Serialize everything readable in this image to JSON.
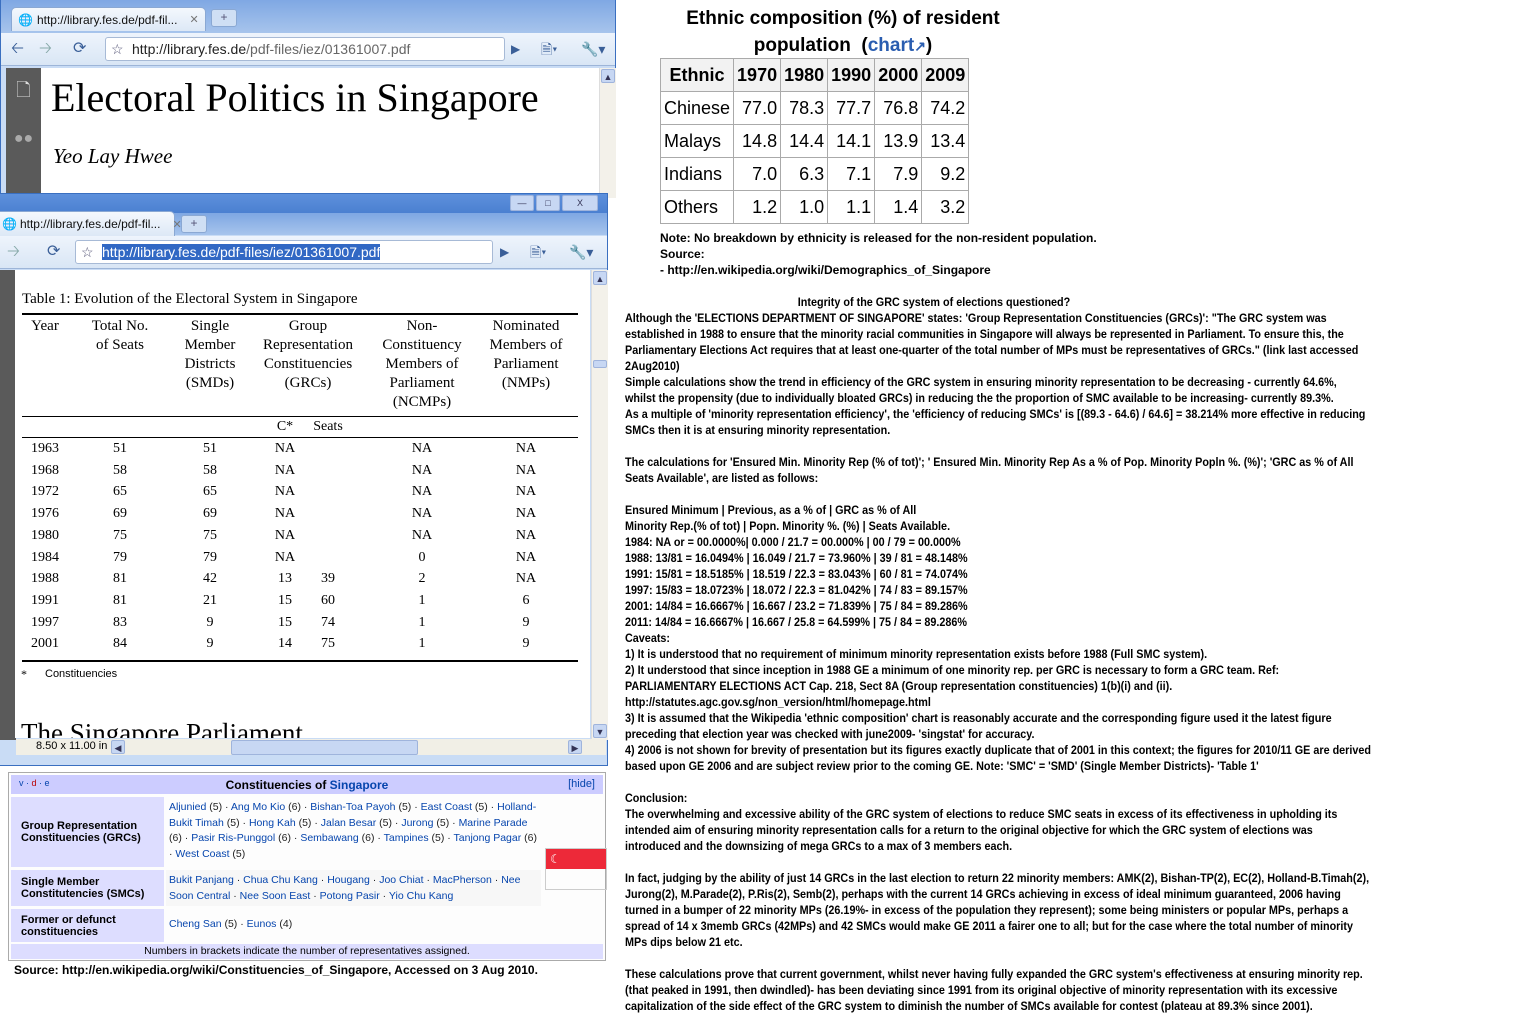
{
  "back_window": {
    "tab_title": "http://library.fes.de/pdf-fil...",
    "url_host": "http://library.fes.de",
    "url_path": "/pdf-files/iez/01361007.pdf",
    "doc_title": "Electoral Politics in Singapore",
    "doc_author": "Yeo Lay Hwee"
  },
  "front_window": {
    "tab_title": "http://library.fes.de/pdf-fil...",
    "url": "http://library.fes.de/pdf-files/iez/01361007.pdf",
    "page_size": "8.50 x 11.00 in",
    "table_caption": "Table 1: Evolution of the Electoral System in Singapore",
    "headers": [
      "Year",
      "Total No.\nof Seats",
      "Single\nMember\nDistricts\n(SMDs)",
      "Group\nRepresentation\nConstituencies\n(GRCs)",
      "Non-\nConstituency\nMembers of\nParliament\n(NCMPs)",
      "Nominated\nMembers of\nParliament\n(NMPs)"
    ],
    "subheaders": [
      "C*",
      "Seats"
    ],
    "rows": [
      [
        "1963",
        "51",
        "51",
        "NA",
        "",
        "NA",
        "NA"
      ],
      [
        "1968",
        "58",
        "58",
        "NA",
        "",
        "NA",
        "NA"
      ],
      [
        "1972",
        "65",
        "65",
        "NA",
        "",
        "NA",
        "NA"
      ],
      [
        "1976",
        "69",
        "69",
        "NA",
        "",
        "NA",
        "NA"
      ],
      [
        "1980",
        "75",
        "75",
        "NA",
        "",
        "NA",
        "NA"
      ],
      [
        "1984",
        "79",
        "79",
        "NA",
        "",
        "0",
        "NA"
      ],
      [
        "1988",
        "81",
        "42",
        "13",
        "39",
        "2",
        "NA"
      ],
      [
        "1991",
        "81",
        "21",
        "15",
        "60",
        "1",
        "6"
      ],
      [
        "1997",
        "83",
        "9",
        "15",
        "74",
        "1",
        "9"
      ],
      [
        "2001",
        "84",
        "9",
        "14",
        "75",
        "1",
        "9"
      ]
    ],
    "footnote_mark": "*",
    "footnote": "Constituencies",
    "next_heading": "The Singapore Parliament"
  },
  "navbox": {
    "vde": [
      "v",
      "d",
      "e"
    ],
    "title_prefix": "Constituencies of ",
    "title_link": "Singapore",
    "hide": "[hide]",
    "groups": [
      {
        "label": "Group Representation Constituencies (GRCs)",
        "items": [
          [
            "Aljunied",
            "(5)"
          ],
          [
            "Ang Mo Kio",
            "(6)"
          ],
          [
            "Bishan-Toa Payoh",
            "(5)"
          ],
          [
            "East Coast",
            "(5)"
          ],
          [
            "Holland-Bukit Timah",
            "(5)"
          ],
          [
            "Hong Kah",
            "(5)"
          ],
          [
            "Jalan Besar",
            "(5)"
          ],
          [
            "Jurong",
            "(5)"
          ],
          [
            "Marine Parade",
            "(6)"
          ],
          [
            "Pasir Ris-Punggol",
            "(6)"
          ],
          [
            "Sembawang",
            "(6)"
          ],
          [
            "Tampines",
            "(5)"
          ],
          [
            "Tanjong Pagar",
            "(6)"
          ],
          [
            "West Coast",
            "(5)"
          ]
        ]
      },
      {
        "label": "Single Member Constitutencies (SMCs)",
        "items": [
          [
            "Bukit Panjang",
            ""
          ],
          [
            "Chua Chu Kang",
            ""
          ],
          [
            "Hougang",
            ""
          ],
          [
            "Joo Chiat",
            ""
          ],
          [
            "MacPherson",
            ""
          ],
          [
            "Nee Soon Central",
            ""
          ],
          [
            "Nee Soon East",
            ""
          ],
          [
            "Potong Pasir",
            ""
          ],
          [
            "Yio Chu Kang",
            ""
          ]
        ]
      },
      {
        "label": "Former or defunct constituencies",
        "items": [
          [
            "Cheng San",
            "(5)"
          ],
          [
            "Eunos",
            "(4)"
          ]
        ]
      }
    ],
    "footer": "Numbers in brackets indicate the number of representatives assigned.",
    "flag_colors": {
      "red": "#ed2939",
      "white": "#ffffff"
    }
  },
  "source_caption": "Source: http://en.wikipedia.org/wiki/Constituencies_of_Singapore, Accessed on 3 Aug 2010.",
  "ethnic": {
    "title_line1": "Ethnic composition (%) of resident",
    "title_line2": "population",
    "chart_link": "chart",
    "headers": [
      "Ethnic",
      "1970",
      "1980",
      "1990",
      "2000",
      "2009"
    ],
    "rows": [
      [
        "Chinese",
        "77.0",
        "78.3",
        "77.7",
        "76.8",
        "74.2"
      ],
      [
        "Malays",
        "14.8",
        "14.4",
        "14.1",
        "13.9",
        "13.4"
      ],
      [
        "Indians",
        "7.0",
        "6.3",
        "7.1",
        "7.9",
        "9.2"
      ],
      [
        "Others",
        "1.2",
        "1.0",
        "1.1",
        "1.4",
        "3.2"
      ]
    ],
    "notes": [
      "Note: No breakdown by ethnicity is released for the non-resident population.",
      "Source:",
      "- http://en.wikipedia.org/wiki/Demographics_of_Singapore"
    ]
  },
  "article": {
    "heading": "Integrity of the GRC system of elections questioned?",
    "lines": [
      "Although the 'ELECTIONS DEPARTMENT OF SINGAPORE' states: 'Group Representation Constituencies (GRCs)': \"The GRC system was",
      "established in 1988 to ensure that the minority racial communities in Singapore will always be represented in Parliament. To ensure this, the",
      "Parliamentary Elections Act requires that at least one-quarter of the total number of MPs must be representatives of GRCs.\"  (link last accessed",
      "2Aug2010)",
      "Simple calculations show the trend in efficiency of the GRC system in ensuring minority representation to be decreasing - currently 64.6%,",
      "whilst the propensity (due to individually bloated GRCs) in reducing the the proportion of SMC available to be increasing- currently 89.3%.",
      "As a  multiple of 'minority representation efficiency', the 'efficiency of reducing SMCs' is [(89.3 - 64.6) / 64.6] = 38.214% more effective in reducing",
      "SMCs then it is at ensuring minority representation.",
      "",
      "The calculations for 'Ensured Min. Minority Rep (% of tot)'; ' Ensured Min. Minority Rep As a % of Pop. Minority Popln %. (%)';  'GRC as % of All",
      "Seats Available', are listed as follows:",
      "",
      "Ensured Minimum        | Previous, as a % of      | GRC as % of All",
      "Minority Rep.(% of tot)  | Popn. Minority %. (%)   | Seats Available.",
      "1984: NA or = 00.0000%|  0.000 / 21.7 = 00.000% | 00 / 79 = 00.000%",
      "1988: 13/81 = 16.0494% | 16.049 / 21.7 = 73.960% | 39 / 81 = 48.148%",
      "1991: 15/81 = 18.5185% | 18.519 / 22.3 = 83.043% | 60 / 81 = 74.074%",
      "1997: 15/83 = 18.0723% | 18.072 / 22.3 = 81.042% | 74 / 83 = 89.157%",
      "2001: 14/84 = 16.6667% | 16.667 / 23.2 = 71.839% | 75 / 84 = 89.286%",
      "2011: 14/84 = 16.6667% | 16.667 / 25.8 = 64.599% | 75 / 84 = 89.286%",
      "Caveats:",
      "1) It is understood that no requirement of minimum minority representation exists before 1988 (Full SMC system).",
      "2) It understood that since inception in 1988 GE a minimum of one minority rep. per GRC is necessary to form a GRC team. Ref:",
      "PARLIAMENTARY ELECTIONS ACT          Cap. 218, Sect 8A (Group representation constituencies) 1(b)(i) and (ii).",
      "http://statutes.agc.gov.sg/non_version/html/homepage.html",
      "3) It is assumed that the Wikipedia 'ethnic composition' chart is reasonably accurate and the corresponding figure used it the latest figure",
      "preceding that election year was checked with june2009- 'singstat' for accuracy.",
      "4) 2006 is not shown for brevity of presentation but its figures exactly duplicate that of 2001 in this context; the figures for 2010/11 GE are derived",
      "based upon GE 2006 and are subject review prior to the coming GE.  Note: 'SMC' = 'SMD' (Single Member Districts)- 'Table 1'",
      "",
      "Conclusion:",
      "The overwhelming and excessive ability of the GRC system of elections to reduce SMC seats in excess of its effectiveness in upholding its",
      "intended aim of ensuring minority representation calls for a return to the original objective for which the GRC system of elections was",
      "introduced and the downsizing of mega GRCs to a max of 3 members each.",
      "",
      "In fact, judging by the ability of just 14 GRCs in the last election to return 22 minority members: AMK(2), Bishan-TP(2), EC(2), Holland-B.Timah(2),",
      "Jurong(2), M.Parade(2), P.Ris(2), Semb(2), perhaps with the current 14 GRCs  achieving in excess of ideal minimum guaranteed, 2006 having",
      "turned in a bumper of 22 minority MPs (26.19%- in excess of the population they represent); some being ministers or popular MPs, perhaps a",
      "spread of 14 x 3memb GRCs (42MPs) and 42 SMCs would make GE 2011 a fairer one to all; but for the case where the total number of minority",
      "MPs dips below 21 etc.",
      "",
      "These calculations prove that current government, whilst never having fully expanded the GRC system's effectiveness at ensuring minority rep.",
      "(that peaked in 1991, then dwindled)- has been deviating since 1991 from its original objective of minority representation with its excessive",
      "capitalization of the side effect of the GRC system to diminish the number of SMCs available for contest (plateau at 89.3% since 2001)."
    ]
  }
}
